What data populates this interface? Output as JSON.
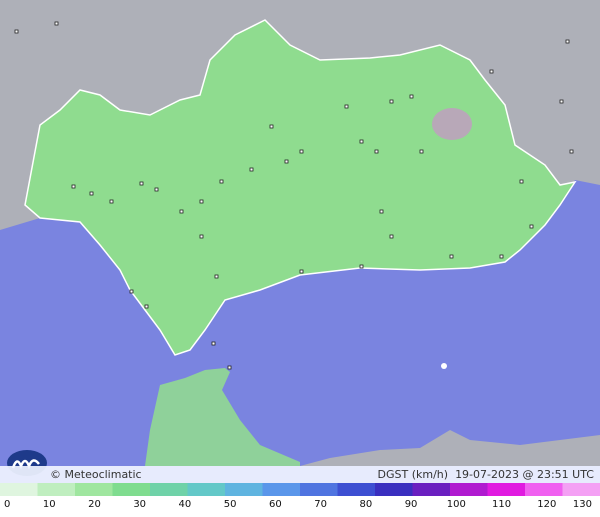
{
  "map": {
    "credit": "© Meteoclimatic",
    "variable": "DGST (km/h)",
    "timestamp": "19-07-2023 @ 23:51 UTC"
  },
  "legend": {
    "ticks": [
      "0",
      "10",
      "20",
      "30",
      "40",
      "50",
      "60",
      "70",
      "80",
      "90",
      "100",
      "110",
      "120",
      "130"
    ],
    "colors": [
      "#dff5df",
      "#bfeebf",
      "#9fe69f",
      "#7fdc8f",
      "#6fd2a8",
      "#63c8c8",
      "#5fb4e0",
      "#5a96ea",
      "#4f74e0",
      "#3d4fd2",
      "#3a2fbf",
      "#6a1fc0",
      "#b01ad0",
      "#e01ae0",
      "#f060f0",
      "#f4a0f4"
    ]
  },
  "colors": {
    "sea": "#7a84e0",
    "land_region": "#8fdc8f",
    "land_other": "#b0b0b8",
    "station": "#ffffff"
  }
}
